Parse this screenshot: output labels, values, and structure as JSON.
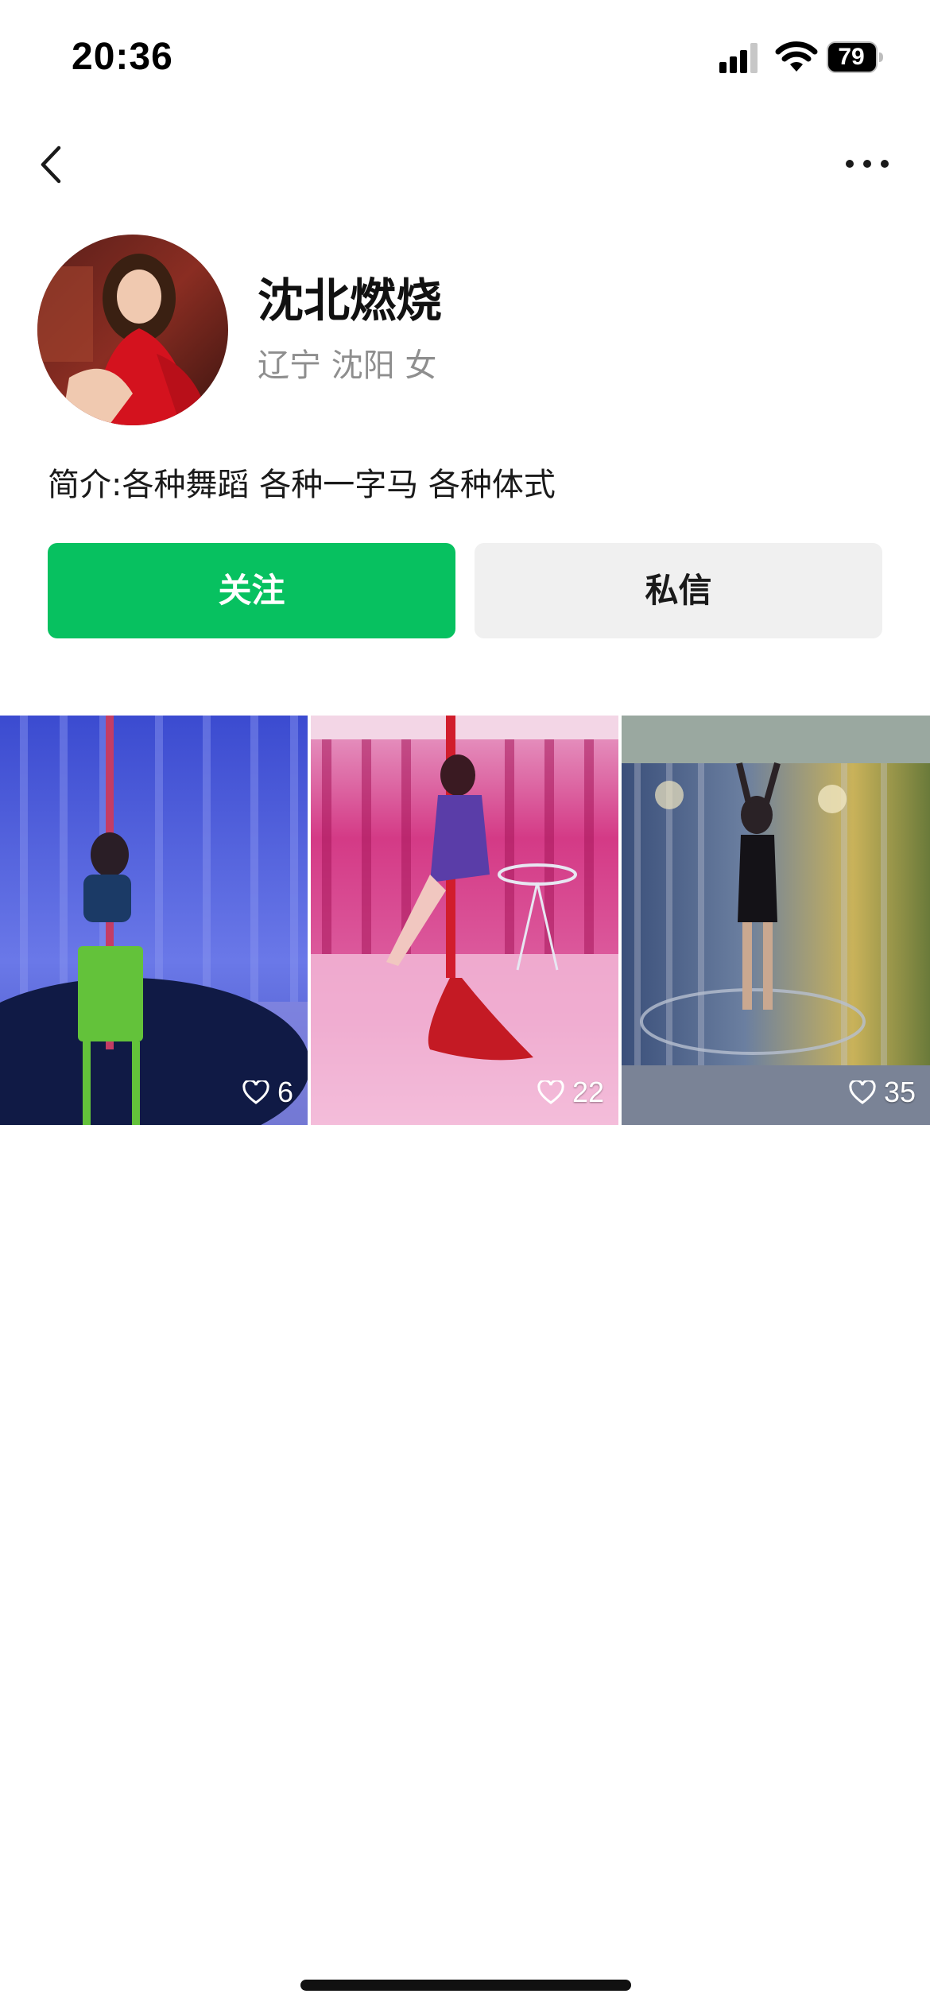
{
  "status_bar": {
    "time": "20:36",
    "battery": "79",
    "icons": [
      "cellular-signal-icon",
      "wifi-icon",
      "battery-icon"
    ]
  },
  "nav": {
    "back_icon": "chevron-left-icon",
    "more_icon": "more-horizontal-icon"
  },
  "profile": {
    "name": "沈北燃烧",
    "location": "辽宁 沈阳 女",
    "bio": "简介:各种舞蹈 各种一字马 各种体式"
  },
  "actions": {
    "follow_label": "关注",
    "message_label": "私信"
  },
  "posts": [
    {
      "likes": "6"
    },
    {
      "likes": "22"
    },
    {
      "likes": "35"
    }
  ],
  "colors": {
    "accent_green": "#07c160",
    "secondary_button": "#f0f0f0",
    "muted_text": "#8e8e8e"
  }
}
